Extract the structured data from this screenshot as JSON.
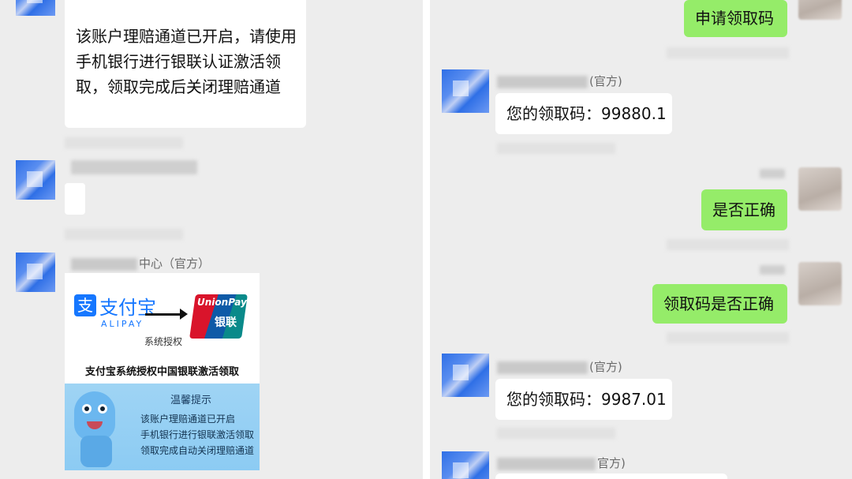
{
  "left": {
    "message1": {
      "text": "该账户理赔通道已开启，请使用手机银行进行银联认证激活领取，领取完成后关闭理赔通道"
    },
    "sender3": {
      "name_visible": "中心（官方）"
    },
    "card": {
      "alipay_cn": "支付宝",
      "alipay_en": "ALIPAY",
      "auth_label": "系统授权",
      "unionpay_en": "UnionPay",
      "unionpay_cn": "银联",
      "title": "支付宝系统授权中国银联激活领取",
      "tip_title": "温馨提示",
      "tip_lines": [
        "该账户理赔通道已开启",
        "手机银行进行银联激活领取",
        "领取完成自动关闭理赔通道"
      ]
    }
  },
  "right": {
    "messages": [
      {
        "side": "out",
        "text": "申请领取码"
      },
      {
        "side": "in",
        "sender_suffix": "(官方)",
        "text": "您的领取码：99880.1"
      },
      {
        "side": "out",
        "text": "是否正确"
      },
      {
        "side": "out",
        "text": "领取码是否正确"
      },
      {
        "side": "in",
        "sender_suffix": "(官方)",
        "text": "您的领取码：9987.01"
      },
      {
        "side": "in",
        "sender_suffix": "官方)"
      }
    ]
  },
  "icons": {
    "alipay": "alipay-logo-icon",
    "unionpay": "unionpay-logo-icon",
    "arrow": "arrow-right-icon"
  }
}
